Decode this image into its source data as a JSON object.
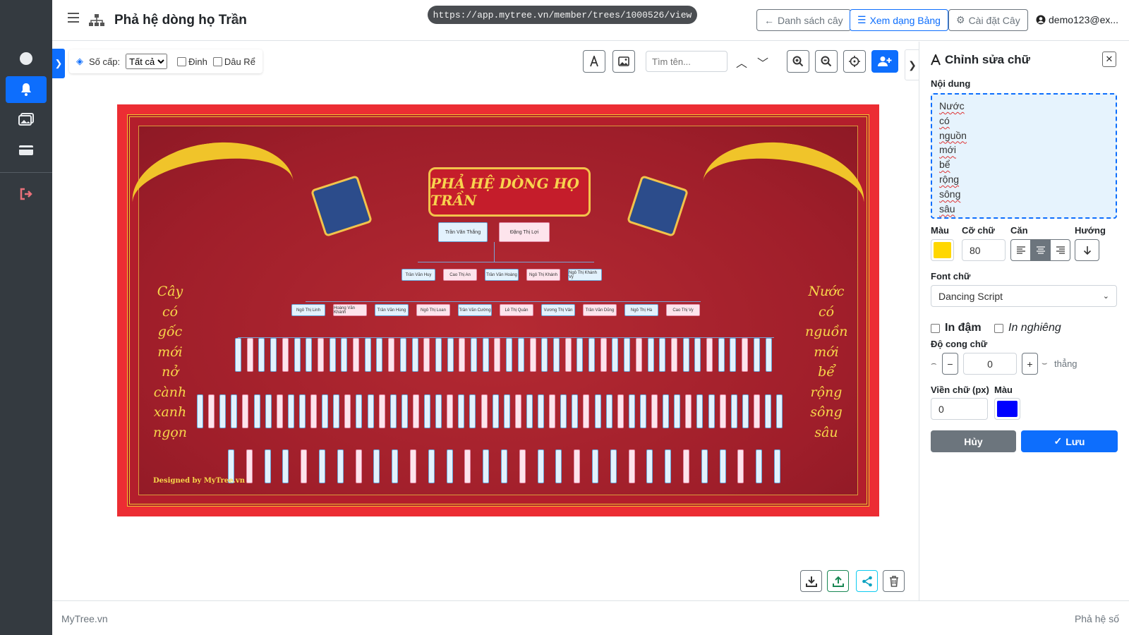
{
  "sidebar": {
    "items": [
      {
        "icon": "circle-icon",
        "active": false
      },
      {
        "icon": "bell-icon",
        "active": true
      },
      {
        "icon": "images-icon",
        "active": false
      },
      {
        "icon": "card-icon",
        "active": false
      },
      {
        "icon": "logout-icon",
        "active": false
      }
    ]
  },
  "header": {
    "title": "Phả hệ dòng họ Trần",
    "url": "https://app.mytree.vn/member/trees/1000526/view",
    "buttons": {
      "tree_list": "Danh sách cây",
      "table_view": "Xem dạng Bảng",
      "tree_settings": "Cài đặt Cây"
    },
    "user": "demo123@ex..."
  },
  "toolbar": {
    "levels_label": "Số cấp:",
    "levels_value": "Tất cả",
    "pin_label": "Đinh",
    "daughter_in_law_label": "Dâu Rể",
    "search_placeholder": "Tìm tên..."
  },
  "poster": {
    "banner_title": "PHẢ HỆ DÒNG HỌ TRẦN",
    "left_poem": [
      "Cây",
      "có",
      "gốc",
      "mới",
      "nở",
      "cành",
      "xanh",
      "ngọn"
    ],
    "right_poem": [
      "Nước",
      "có",
      "nguồn",
      "mới",
      "bể",
      "rộng",
      "sông",
      "sâu"
    ],
    "designed_by": "Designed by MyTree.vn",
    "root_couple": [
      "Trần Văn Thắng",
      "Đặng Thị Lợi"
    ],
    "gen2": [
      "Trần Văn Huy",
      "Cao Thị An",
      "Trần Văn Hoàng",
      "Ngô Thị Khánh",
      "Ngô Thị Khánh Vy"
    ],
    "gen3": [
      "Ngô Thị Linh",
      "Hoàng Văn Khánh",
      "Trần Văn Hùng",
      "Ngô Thị Loan",
      "Trần Văn Cường",
      "Lê Thị Quân",
      "Vương Thị Vân",
      "Trần Văn Dũng",
      "Ngô Thị Hà",
      "Cao Thị Vy"
    ]
  },
  "panel": {
    "title": "Chỉnh sửa chữ",
    "content_label": "Nội dung",
    "content_lines": [
      "Nước",
      "có",
      "nguồn",
      "mới",
      "bể",
      "rộng",
      "sông",
      "sâu"
    ],
    "color_label": "Màu",
    "text_color": "#FFD700",
    "font_size_label": "Cỡ chữ",
    "font_size_value": "80",
    "align_label": "Căn",
    "align_value": "center",
    "direction_label": "Hướng",
    "font_label": "Font chữ",
    "font_value": "Dancing Script",
    "bold_label": "In đậm",
    "italic_label": "In nghiêng",
    "curve_label": "Độ cong chữ",
    "curve_value": "0",
    "curve_hint": "thẳng",
    "stroke_label": "Viền chữ (px)",
    "stroke_value": "0",
    "stroke_color_label": "Màu",
    "stroke_color": "#0000FF",
    "cancel": "Hủy",
    "save": "Lưu"
  },
  "footer": {
    "brand": "MyTree.vn",
    "section": "Phả hệ số"
  }
}
